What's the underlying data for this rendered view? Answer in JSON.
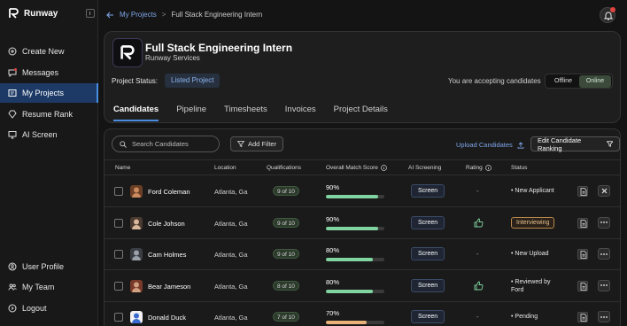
{
  "app": {
    "name": "Runway"
  },
  "sidebar": {
    "top_items": [
      {
        "label": "Create New",
        "icon": "plus-circle-icon"
      },
      {
        "label": "Messages",
        "icon": "chat-icon"
      },
      {
        "label": "My Projects",
        "icon": "folder-icon",
        "active": true
      },
      {
        "label": "Resume Rank",
        "icon": "diamond-icon"
      },
      {
        "label": "AI Screen",
        "icon": "monitor-icon"
      }
    ],
    "bottom_items": [
      {
        "label": "User Profile",
        "icon": "user-icon"
      },
      {
        "label": "My Team",
        "icon": "team-icon"
      },
      {
        "label": "Logout",
        "icon": "logout-icon"
      }
    ]
  },
  "breadcrumb": {
    "parent": "My Projects",
    "separator": ">",
    "current": "Full Stack Engineering Intern"
  },
  "project": {
    "title": "Full Stack Engineering Intern",
    "company": "Runway Services",
    "status_label": "Project Status:",
    "status": "Listed Project",
    "accepting_text": "You are accepting candidates",
    "toggle_off": "Offline",
    "toggle_on": "Online",
    "toggle_selected": "Online",
    "tabs": [
      "Candidates",
      "Pipeline",
      "Timesheets",
      "Invoices",
      "Project Details"
    ],
    "active_tab": "Candidates"
  },
  "candidates": {
    "search_placeholder": "Search Candidates",
    "add_filter": "Add Filter",
    "upload": "Upload Candidates",
    "edit_ranking": "Edit Candidate Ranking",
    "columns": [
      "Name",
      "Location",
      "Qualifications",
      "Overall Match Score",
      "AI Screening",
      "Rating",
      "Status"
    ],
    "screen_label": "Screen",
    "rows": [
      {
        "name": "Ford Coleman",
        "location": "Atlanta, Ga",
        "qualifications": "9 of 10",
        "score": "90%",
        "score_value": 90,
        "bar_color": "#7fd4a0",
        "rating": "-",
        "status": "• New Applicant",
        "status_type": "text",
        "action": "close"
      },
      {
        "name": "Cole Johson",
        "location": "Atlanta, Ga",
        "qualifications": "9 of 10",
        "score": "90%",
        "score_value": 90,
        "bar_color": "#7fd4a0",
        "rating": "thumbs-up",
        "status": "Interviewing",
        "status_type": "pill",
        "action": "more"
      },
      {
        "name": "Cam Holmes",
        "location": "Atlanta, Ga",
        "qualifications": "9 of 10",
        "score": "80%",
        "score_value": 80,
        "bar_color": "#7fd4a0",
        "rating": "-",
        "status": "• New Upload",
        "status_type": "text",
        "action": "more"
      },
      {
        "name": "Bear Jameson",
        "location": "Atlanta, Ga",
        "qualifications": "8 of 10",
        "score": "80%",
        "score_value": 80,
        "bar_color": "#7fd4a0",
        "rating": "thumbs-up",
        "status": "• Reviewed by Ford",
        "status_type": "text2",
        "action": "more"
      },
      {
        "name": "Donald Duck",
        "location": "Atlanta, Ga",
        "qualifications": "7 of 10",
        "score": "70%",
        "score_value": 70,
        "bar_color": "#e8b27a",
        "rating": "-",
        "status": "• Pending",
        "status_type": "text",
        "action": "more"
      }
    ]
  }
}
